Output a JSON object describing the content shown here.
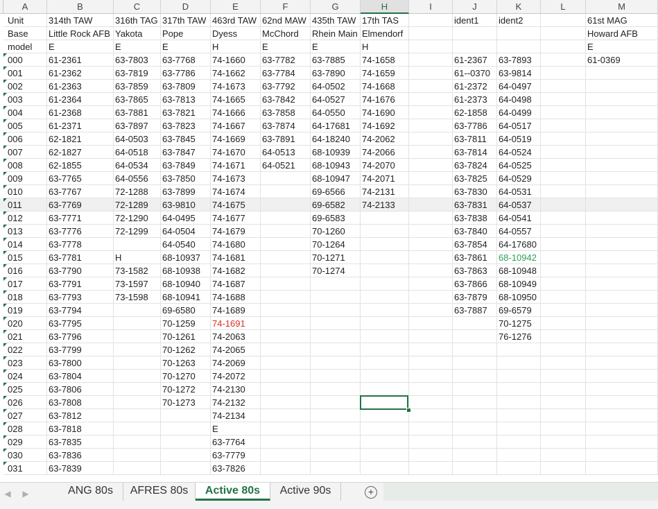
{
  "columns": [
    {
      "letter": "A"
    },
    {
      "letter": "B"
    },
    {
      "letter": "C"
    },
    {
      "letter": "D"
    },
    {
      "letter": "E"
    },
    {
      "letter": "F"
    },
    {
      "letter": "G"
    },
    {
      "letter": "H"
    },
    {
      "letter": "I"
    },
    {
      "letter": "J"
    },
    {
      "letter": "K"
    },
    {
      "letter": "L"
    },
    {
      "letter": "M"
    }
  ],
  "selected_column": "H",
  "rows": [
    [
      "Unit",
      "314th TAW",
      "316th TAG",
      "317th TAW",
      "463rd TAW",
      "62nd MAW",
      "435th TAW",
      "17th TAS",
      "",
      "ident1",
      "ident2",
      "",
      "61st MAG"
    ],
    [
      "Base",
      "Little Rock AFB",
      "Yakota",
      "Pope",
      "Dyess",
      "McChord",
      "Rhein Main",
      "Elmendorf",
      "",
      "",
      "",
      "",
      "Howard AFB"
    ],
    [
      "model",
      "E",
      "E",
      "E",
      "H",
      "E",
      "E",
      "H",
      "",
      "",
      "",
      "",
      "E"
    ],
    [
      "000",
      "61-2361",
      "63-7803",
      "63-7768",
      "74-1660",
      "63-7782",
      "63-7885",
      "74-1658",
      "",
      "61-2367",
      "63-7893",
      "",
      "61-0369"
    ],
    [
      "001",
      "61-2362",
      "63-7819",
      "63-7786",
      "74-1662",
      "63-7784",
      "63-7890",
      "74-1659",
      "",
      "61--0370",
      "63-9814",
      "",
      ""
    ],
    [
      "002",
      "61-2363",
      "63-7859",
      "63-7809",
      "74-1673",
      "63-7792",
      "64-0502",
      "74-1668",
      "",
      "61-2372",
      "64-0497",
      "",
      ""
    ],
    [
      "003",
      "61-2364",
      "63-7865",
      "63-7813",
      "74-1665",
      "63-7842",
      "64-0527",
      "74-1676",
      "",
      "61-2373",
      "64-0498",
      "",
      ""
    ],
    [
      "004",
      "61-2368",
      "63-7881",
      "63-7821",
      "74-1666",
      "63-7858",
      "64-0550",
      "74-1690",
      "",
      "62-1858",
      "64-0499",
      "",
      ""
    ],
    [
      "005",
      "61-2371",
      "63-7897",
      "63-7823",
      "74-1667",
      "63-7874",
      "64-17681",
      "74-1692",
      "",
      "63-7786",
      "64-0517",
      "",
      ""
    ],
    [
      "006",
      "62-1821",
      "64-0503",
      "63-7845",
      "74-1669",
      "63-7891",
      "64-18240",
      "74-2062",
      "",
      "63-7811",
      "64-0519",
      "",
      ""
    ],
    [
      "007",
      "62-1827",
      "64-0518",
      "63-7847",
      "74-1670",
      "64-0513",
      "68-10939",
      "74-2066",
      "",
      "63-7814",
      "64-0524",
      "",
      ""
    ],
    [
      "008",
      "62-1855",
      "64-0534",
      "63-7849",
      "74-1671",
      "64-0521",
      "68-10943",
      "74-2070",
      "",
      "63-7824",
      "64-0525",
      "",
      ""
    ],
    [
      "009",
      "63-7765",
      "64-0556",
      "63-7850",
      "74-1673",
      "",
      "68-10947",
      "74-2071",
      "",
      "63-7825",
      "64-0529",
      "",
      ""
    ],
    [
      "010",
      "63-7767",
      "72-1288",
      "63-7899",
      "74-1674",
      "",
      "69-6566",
      "74-2131",
      "",
      "63-7830",
      "64-0531",
      "",
      ""
    ],
    [
      "011",
      "63-7769",
      "72-1289",
      "63-9810",
      "74-1675",
      "",
      "69-6582",
      "74-2133",
      "",
      "63-7831",
      "64-0537",
      "",
      ""
    ],
    [
      "012",
      "63-7771",
      "72-1290",
      "64-0495",
      "74-1677",
      "",
      "69-6583",
      "",
      "",
      "63-7838",
      "64-0541",
      "",
      ""
    ],
    [
      "013",
      "63-7776",
      "72-1299",
      "64-0504",
      "74-1679",
      "",
      "70-1260",
      "",
      "",
      "63-7840",
      "64-0557",
      "",
      ""
    ],
    [
      "014",
      "63-7778",
      "",
      "64-0540",
      "74-1680",
      "",
      "70-1264",
      "",
      "",
      "63-7854",
      "64-17680",
      "",
      ""
    ],
    [
      "015",
      "63-7781",
      "H",
      "68-10937",
      "74-1681",
      "",
      "70-1271",
      "",
      "",
      "63-7861",
      "68-10942",
      "",
      ""
    ],
    [
      "016",
      "63-7790",
      "73-1582",
      "68-10938",
      "74-1682",
      "",
      "70-1274",
      "",
      "",
      "63-7863",
      "68-10948",
      "",
      ""
    ],
    [
      "017",
      "63-7791",
      "73-1597",
      "68-10940",
      "74-1687",
      "",
      "",
      "",
      "",
      "63-7866",
      "68-10949",
      "",
      ""
    ],
    [
      "018",
      "63-7793",
      "73-1598",
      "68-10941",
      "74-1688",
      "",
      "",
      "",
      "",
      "63-7879",
      "68-10950",
      "",
      ""
    ],
    [
      "019",
      "63-7794",
      "",
      "69-6580",
      "74-1689",
      "",
      "",
      "",
      "",
      "63-7887",
      "69-6579",
      "",
      ""
    ],
    [
      "020",
      "63-7795",
      "",
      "70-1259",
      "74-1691",
      "",
      "",
      "",
      "",
      "",
      "70-1275",
      "",
      ""
    ],
    [
      "021",
      "63-7796",
      "",
      "70-1261",
      "74-2063",
      "",
      "",
      "",
      "",
      "",
      "76-1276",
      "",
      ""
    ],
    [
      "022",
      "63-7799",
      "",
      "70-1262",
      "74-2065",
      "",
      "",
      "",
      "",
      "",
      "",
      "",
      ""
    ],
    [
      "023",
      "63-7800",
      "",
      "70-1263",
      "74-2069",
      "",
      "",
      "",
      "",
      "",
      "",
      "",
      ""
    ],
    [
      "024",
      "63-7804",
      "",
      "70-1270",
      "74-2072",
      "",
      "",
      "",
      "",
      "",
      "",
      "",
      ""
    ],
    [
      "025",
      "63-7806",
      "",
      "70-1272",
      "74-2130",
      "",
      "",
      "",
      "",
      "",
      "",
      "",
      ""
    ],
    [
      "026",
      "63-7808",
      "",
      "70-1273",
      "74-2132",
      "",
      "",
      "",
      "",
      "",
      "",
      "",
      ""
    ],
    [
      "027",
      "63-7812",
      "",
      "",
      "74-2134",
      "",
      "",
      "",
      "",
      "",
      "",
      "",
      ""
    ],
    [
      "028",
      "63-7818",
      "",
      "",
      "E",
      "",
      "",
      "",
      "",
      "",
      "",
      "",
      ""
    ],
    [
      "029",
      "63-7835",
      "",
      "",
      "63-7764",
      "",
      "",
      "",
      "",
      "",
      "",
      "",
      ""
    ],
    [
      "030",
      "63-7836",
      "",
      "",
      "63-7779",
      "",
      "",
      "",
      "",
      "",
      "",
      "",
      ""
    ],
    [
      "031",
      "63-7839",
      "",
      "",
      "63-7826",
      "",
      "",
      "",
      "",
      "",
      "",
      "",
      ""
    ]
  ],
  "colored_cells": {
    "23-4": "#d93025",
    "18-10": "#2e9e57"
  },
  "sheet_tabs": [
    {
      "label": "ANG 80s",
      "active": false
    },
    {
      "label": "AFRES 80s",
      "active": false
    },
    {
      "label": "Active 80s",
      "active": true
    },
    {
      "label": "Active 90s",
      "active": false
    }
  ],
  "tab_nav": {
    "prev_icon": "◀",
    "next_icon": "▶",
    "add_icon": "+"
  }
}
